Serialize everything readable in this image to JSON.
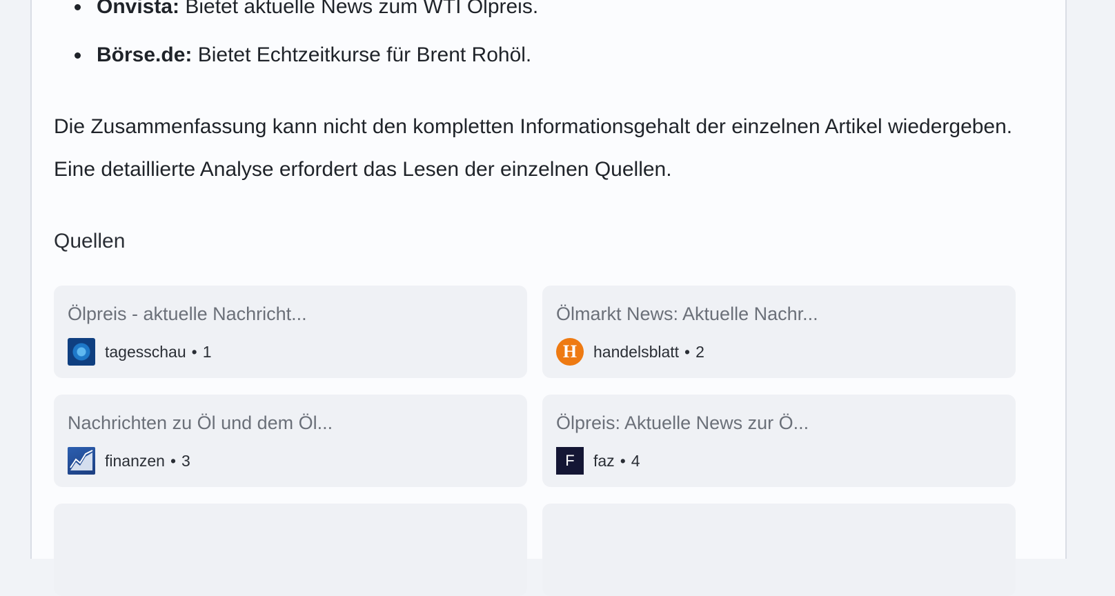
{
  "list_items": [
    {
      "bold": "Onvista:",
      "text": " Bietet aktuelle News zum WTI Ölpreis."
    },
    {
      "bold": "Börse.de:",
      "text": " Bietet Echtzeitkurse für Brent Rohöl."
    }
  ],
  "summary_paragraph": "Die Zusammenfassung kann nicht den kompletten Informationsgehalt der einzelnen Artikel wiedergeben. Eine detaillierte Analyse erfordert das Lesen der einzelnen Quellen.",
  "sources_heading": "Quellen",
  "sources": [
    {
      "title": "Ölpreis - aktuelle Nachricht...",
      "site": "tagesschau",
      "index": "1",
      "icon": "tagesschau-logo-icon"
    },
    {
      "title": "Ölmarkt News: Aktuelle Nachr...",
      "site": "handelsblatt",
      "index": "2",
      "icon": "handelsblatt-logo-icon",
      "icon_letter": "H"
    },
    {
      "title": "Nachrichten zu Öl und dem Öl...",
      "site": "finanzen",
      "index": "3",
      "icon": "finanzen-logo-icon"
    },
    {
      "title": "Ölpreis: Aktuelle News zur Ö...",
      "site": "faz",
      "index": "4",
      "icon": "faz-logo-icon",
      "icon_letter": "F"
    }
  ],
  "separator": "•",
  "colors": {
    "background": "#f1f3f7",
    "panel": "#fbfcfe",
    "card": "#eff1f5",
    "handelsblatt_orange": "#ee7a12",
    "faz_navy": "#141634"
  }
}
